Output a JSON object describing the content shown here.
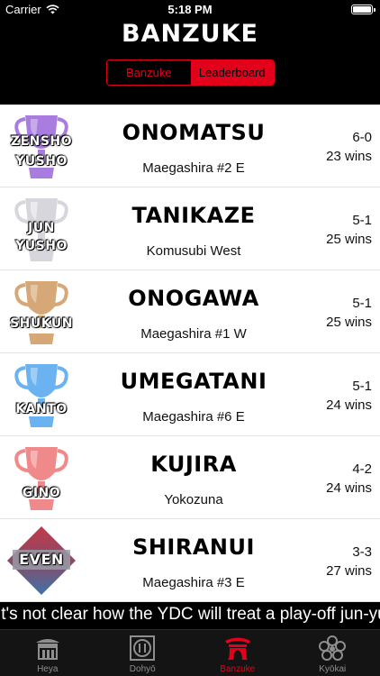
{
  "status_bar": {
    "carrier": "Carrier",
    "time": "5:18 PM"
  },
  "header": {
    "title": "BANZUKE",
    "segments": [
      {
        "label": "Banzuke",
        "active": false
      },
      {
        "label": "Leaderboard",
        "active": true
      }
    ]
  },
  "leaderboard": [
    {
      "award_line1": "ZENSHO",
      "award_line2": "YUSHO",
      "trophy_color": "#a97de0",
      "name": "ONOMATSU",
      "rank": "Maegashira #2 E",
      "record": "6-0",
      "wins": "23 wins"
    },
    {
      "award_line1": "JUN",
      "award_line2": "YUSHO",
      "trophy_color": "#d6d6dc",
      "name": "TANIKAZE",
      "rank": "Komusubi West",
      "record": "5-1",
      "wins": "25 wins"
    },
    {
      "award_line1": "SHUKUN",
      "award_line2": "",
      "trophy_color": "#d6a878",
      "name": "ONOGAWA",
      "rank": "Maegashira #1 W",
      "record": "5-1",
      "wins": "25 wins"
    },
    {
      "award_line1": "KANTO",
      "award_line2": "",
      "trophy_color": "#6ab2f0",
      "name": "UMEGATANI",
      "rank": "Maegashira #6 E",
      "record": "5-1",
      "wins": "24 wins"
    },
    {
      "award_line1": "GINO",
      "award_line2": "",
      "trophy_color": "#f08a8a",
      "name": "KUJIRA",
      "rank": "Yokozuna",
      "record": "4-2",
      "wins": "24 wins"
    },
    {
      "award_line1": "EVEN",
      "award_line2": "",
      "trophy_color": "#c23a4a",
      "name": "SHIRANUI",
      "rank": "Maegashira #3 E",
      "record": "3-3",
      "wins": "27 wins"
    }
  ],
  "ticker": "it's not clear how the YDC will treat a play-off jun-yusho",
  "tabs": [
    {
      "label": "Heya",
      "icon": "heya-building-icon",
      "active": false
    },
    {
      "label": "Dohyō",
      "icon": "dohyo-ring-icon",
      "active": false
    },
    {
      "label": "Banzuke",
      "icon": "banzuke-gate-icon",
      "active": true
    },
    {
      "label": "Kyōkai",
      "icon": "kyokai-flower-icon",
      "active": false
    }
  ],
  "colors": {
    "accent": "#e3001b",
    "background": "#000000",
    "list_background": "#ffffff"
  }
}
